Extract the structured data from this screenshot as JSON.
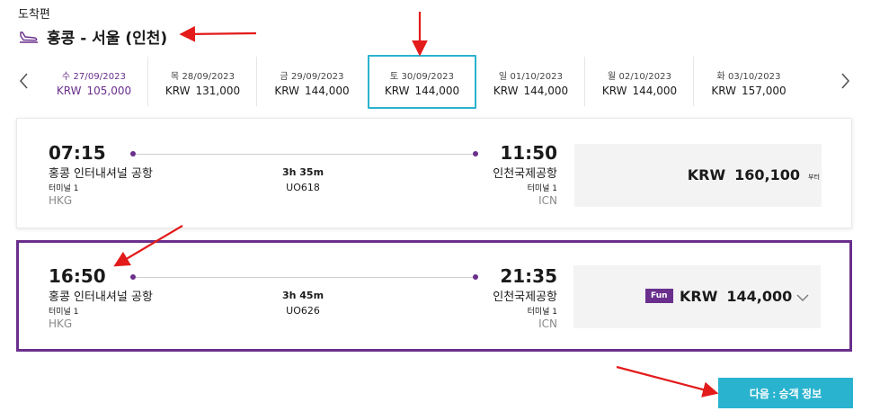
{
  "header": {
    "section_label": "도착편",
    "route_title": "홍콩 - 서울 (인천)"
  },
  "date_strip": [
    {
      "date": "수 27/09/2023",
      "currency": "KRW",
      "price": "105,000"
    },
    {
      "date": "목 28/09/2023",
      "currency": "KRW",
      "price": "131,000"
    },
    {
      "date": "금 29/09/2023",
      "currency": "KRW",
      "price": "144,000"
    },
    {
      "date": "토 30/09/2023",
      "currency": "KRW",
      "price": "144,000"
    },
    {
      "date": "일 01/10/2023",
      "currency": "KRW",
      "price": "144,000"
    },
    {
      "date": "월 02/10/2023",
      "currency": "KRW",
      "price": "144,000"
    },
    {
      "date": "화 03/10/2023",
      "currency": "KRW",
      "price": "157,000"
    }
  ],
  "flights": [
    {
      "depart_time": "07:15",
      "depart_airport": "홍콩 인터내셔널 공항",
      "depart_terminal": "터미널 1",
      "depart_code": "HKG",
      "duration": "3h 35m",
      "flight_no": "UO618",
      "arrive_time": "11:50",
      "arrive_airport": "인천국제공항",
      "arrive_terminal": "터미널 1",
      "arrive_code": "ICN",
      "currency": "KRW",
      "price": "160,100",
      "from_label": "부터"
    },
    {
      "depart_time": "16:50",
      "depart_airport": "홍콩 인터내셔널 공항",
      "depart_terminal": "터미널 1",
      "depart_code": "HKG",
      "duration": "3h 45m",
      "flight_no": "UO626",
      "arrive_time": "21:35",
      "arrive_airport": "인천국제공항",
      "arrive_terminal": "터미널 1",
      "arrive_code": "ICN",
      "fare_badge": "Fun",
      "currency": "KRW",
      "price": "144,000"
    }
  ],
  "next_button": "다음 : 승객 정보",
  "colors": {
    "brand_purple": "#6a2f8c",
    "accent_cyan": "#2ab3cf",
    "annotation_red": "#e31b1b"
  }
}
